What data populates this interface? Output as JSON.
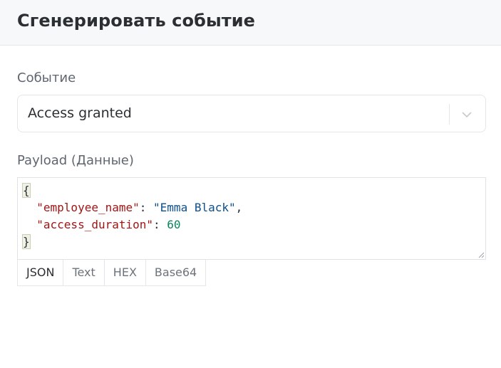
{
  "header": {
    "title": "Сгенерировать событие"
  },
  "event": {
    "label": "Событие",
    "selected": "Access granted"
  },
  "payload": {
    "label": "Payload (Данные)",
    "json": {
      "open_brace": "{",
      "close_brace": "}",
      "fields": [
        {
          "key": "\"employee_name\"",
          "value": "\"Emma Black\"",
          "suffix": ","
        },
        {
          "key": "\"access_duration\"",
          "value": "60",
          "suffix": ""
        }
      ]
    },
    "tabs": [
      "JSON",
      "Text",
      "HEX",
      "Base64"
    ],
    "active_tab": "JSON"
  },
  "colors": {
    "key": "#a31515",
    "string": "#0d4f8b",
    "number": "#098658"
  }
}
